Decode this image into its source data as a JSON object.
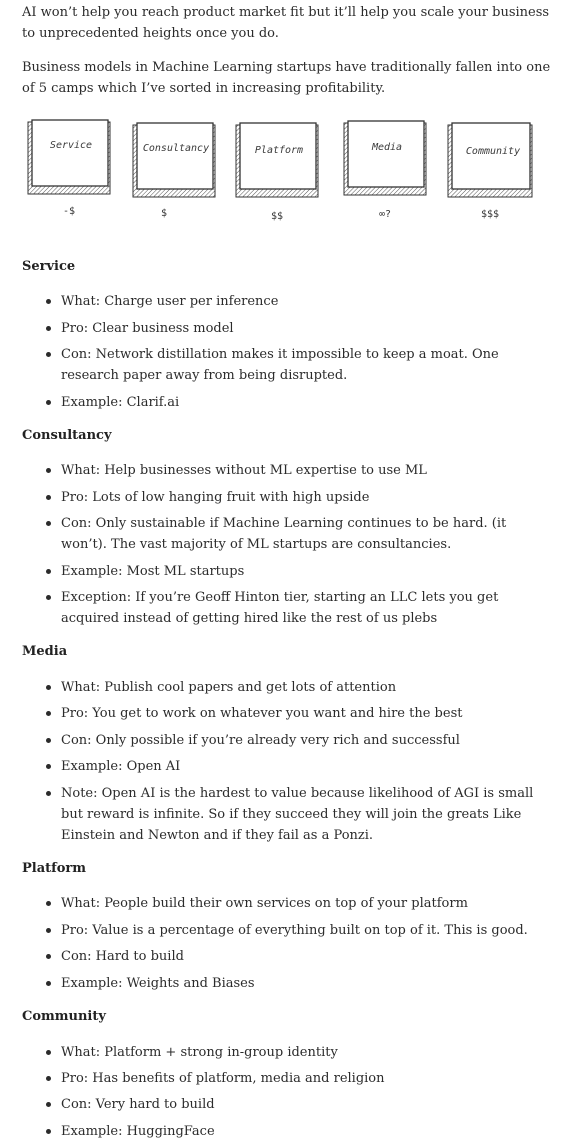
{
  "intro": [
    "AI won’t help you reach product market fit but it’ll help you scale your business to unprecedented heights once you do.",
    "Business models in Machine Learning startups have traditionally fallen into one of 5 camps which I’ve sorted in increasing profitability."
  ],
  "diagram": {
    "boxes": [
      {
        "label": "Service",
        "price": "-$"
      },
      {
        "label": "Consultancy",
        "price": "$"
      },
      {
        "label": "Platform",
        "price": "$$"
      },
      {
        "label": "Media",
        "price": "∞?"
      },
      {
        "label": "Community",
        "price": "$$$"
      }
    ]
  },
  "sections": [
    {
      "heading": "Service",
      "items": [
        "What: Charge user per inference",
        "Pro: Clear business model",
        "Con: Network distillation makes it impossible to keep a moat. One research paper away from being disrupted.",
        "Example: Clarif.ai"
      ]
    },
    {
      "heading": "Consultancy",
      "items": [
        "What: Help businesses without ML expertise to use ML",
        "Pro: Lots of low hanging fruit with high upside",
        "Con: Only sustainable if Machine Learning continues to be hard. (it won’t). The vast majority of ML startups are consultancies.",
        "Example: Most ML startups",
        "Exception: If you’re Geoff Hinton tier, starting an LLC lets you get acquired instead of getting hired like the rest of us plebs"
      ]
    },
    {
      "heading": "Media",
      "items": [
        "What: Publish cool papers and get lots of attention",
        "Pro: You get to work on whatever you want and hire the best",
        "Con: Only possible if you’re already very rich and successful",
        "Example: Open AI",
        "Note: Open AI is the hardest to value because likelihood of AGI is small but reward is infinite. So if they succeed they will join the greats Like Einstein and Newton and if they fail as a Ponzi."
      ]
    },
    {
      "heading": "Platform",
      "items": [
        "What: People build their own services on top of your platform",
        "Pro: Value is a percentage of everything built on top of it. This is good.",
        "Con: Hard to build",
        "Example: Weights and Biases"
      ]
    },
    {
      "heading": "Community",
      "items": [
        "What: Platform + strong in-group identity",
        "Pro: Has benefits of platform, media and religion",
        "Con: Very hard to build",
        "Example: HuggingFace"
      ]
    }
  ]
}
